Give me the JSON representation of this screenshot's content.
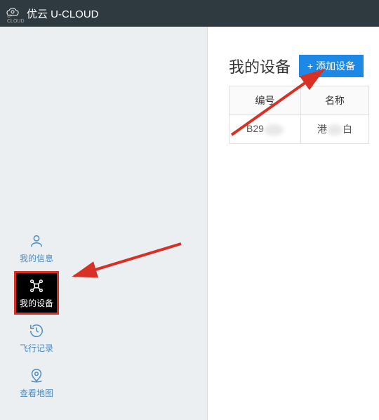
{
  "header": {
    "brand": "优云 U-CLOUD",
    "logo_sub": "U-CLOUD"
  },
  "sidebar": {
    "items": [
      {
        "label": "我的信息",
        "icon": "user-icon",
        "active": false
      },
      {
        "label": "我的设备",
        "icon": "drone-icon",
        "active": true
      },
      {
        "label": "飞行记录",
        "icon": "clock-icon",
        "active": false
      },
      {
        "label": "查看地图",
        "icon": "map-pin-icon",
        "active": false
      }
    ]
  },
  "content": {
    "title": "我的设备",
    "add_button": "+ 添加设备",
    "table": {
      "headers": [
        "编号",
        "名称"
      ],
      "rows": [
        {
          "id_prefix": "B29",
          "name_prefix": "港",
          "name_suffix": "白"
        }
      ]
    }
  },
  "colors": {
    "header_bg": "#2e3a3f",
    "accent": "#1e88e5",
    "highlight_border": "#d93025",
    "sidebar_bg": "#eceff1",
    "icon": "#4a8cc7"
  }
}
